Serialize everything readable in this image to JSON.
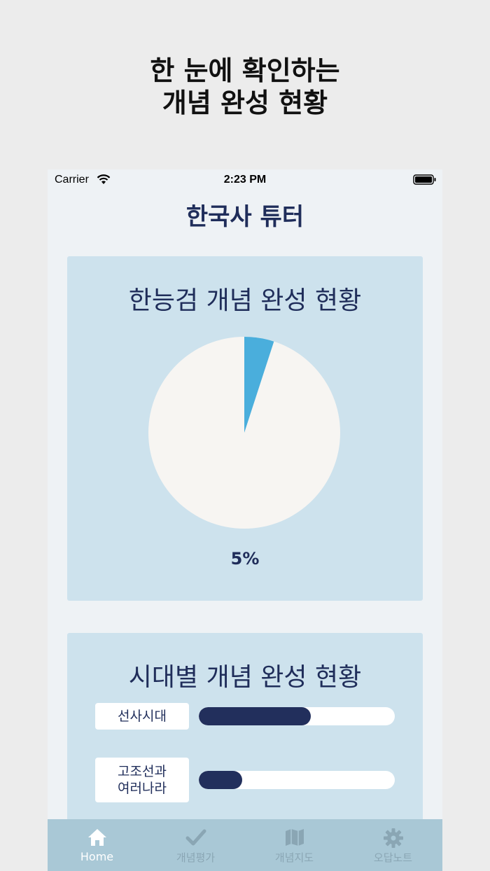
{
  "headline": {
    "line1": "한 눈에 확인하는",
    "line2": "개념 완성 현황"
  },
  "status_bar": {
    "carrier": "Carrier",
    "time": "2:23 PM"
  },
  "app": {
    "title": "한국사 튜터"
  },
  "overall_card": {
    "title": "한능검 개념 완성 현황",
    "percent_label": "5%",
    "percent_value": 5,
    "fill_color": "#4aaedc",
    "rest_color": "#f7f5f2"
  },
  "era_card": {
    "title": "시대별 개념 완성 현황",
    "eras": [
      {
        "line1": "선사시대",
        "line2": "",
        "progress": 0.57
      },
      {
        "line1": "고조선과",
        "line2": "여러나라",
        "progress": 0.22
      }
    ]
  },
  "tabbar": {
    "tabs": [
      {
        "label": "Home",
        "icon": "home-icon",
        "active": true
      },
      {
        "label": "개념평가",
        "icon": "checkmark-icon",
        "active": false
      },
      {
        "label": "개념지도",
        "icon": "map-icon",
        "active": false
      },
      {
        "label": "오답노트",
        "icon": "gear-icon",
        "active": false
      }
    ]
  }
}
